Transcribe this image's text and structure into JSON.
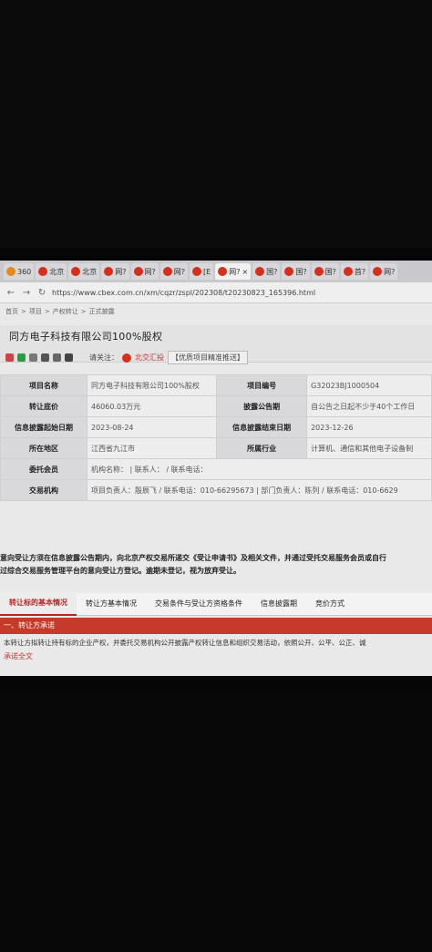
{
  "browser": {
    "tabs": [
      {
        "label": "360",
        "icon": "360-icon",
        "active": false
      },
      {
        "label": "北京",
        "icon": "site-icon",
        "active": false
      },
      {
        "label": "北京",
        "icon": "site-icon",
        "active": false
      },
      {
        "label": "网?",
        "icon": "site-icon",
        "active": false
      },
      {
        "label": "网?",
        "icon": "site-icon",
        "active": false
      },
      {
        "label": "网?",
        "icon": "site-icon",
        "active": false
      },
      {
        "label": "[E",
        "icon": "site-icon",
        "active": false
      },
      {
        "label": "网?",
        "icon": "site-icon",
        "active": true
      },
      {
        "label": "国?",
        "icon": "site-icon",
        "active": false
      },
      {
        "label": "国?",
        "icon": "site-icon",
        "active": false
      },
      {
        "label": "国?",
        "icon": "site-icon",
        "active": false
      },
      {
        "label": "首?",
        "icon": "site-icon",
        "active": false
      },
      {
        "label": "网?",
        "icon": "site-icon",
        "active": false
      }
    ],
    "url": "https://www.cbex.com.cn/xm/cqzr/zspl/202308/t20230823_165396.html"
  },
  "breadcrumb": [
    "首页",
    ">",
    "项目",
    ">",
    "产权转让",
    ">",
    "正式披露"
  ],
  "page_title": "同方电子科技有限公司100%股权",
  "actions": {
    "follow_label": "请关注：",
    "exchange_label": "北交汇投",
    "tag_label": "【优质项目精准推送】"
  },
  "info_table": [
    {
      "label": "项目名称",
      "value": "同方电子科技有限公司100%股权",
      "label2": "项目编号",
      "value2": "G32023BJ1000504"
    },
    {
      "label": "转让底价",
      "value": "46060.03万元",
      "label2": "披露公告期",
      "value2": "自公告之日起不少于40个工作日"
    },
    {
      "label": "信息披露起始日期",
      "value": "2023-08-24",
      "label2": "信息披露结束日期",
      "value2": "2023-12-26"
    },
    {
      "label": "所在地区",
      "value": "江西省九江市",
      "label2": "所属行业",
      "value2": "计算机、通信和其他电子设备制"
    },
    {
      "label": "委托会员",
      "value": "机构名称：   | 联系人：   / 联系电话："
    },
    {
      "label": "交易机构",
      "value": "项目负责人：殷辰飞 / 联系电话：010-66295673 | 部门负责人：陈列 / 联系电话：010-6629"
    }
  ],
  "notice": [
    "意向受让方须在信息披露公告期内，向北京产权交易所递交《受让申请书》及相关文件，并通过受托交易服务会员或自行",
    "过综合交易服务管理平台的意向受让方登记。逾期未登记，视为放弃受让。"
  ],
  "detail_tabs": [
    "转让标的基本情况",
    "转让方基本情况",
    "交易条件与受让方资格条件",
    "信息披露期",
    "竞价方式"
  ],
  "section_title": "一、转让方承诺",
  "promise_text": "本转让方拟转让持有标的企业产权，并委托交易机构公开披露产权转让信息和组织交易活动，依照公开、公平、公正、诚",
  "promise_link": "承诺全文",
  "colors": {
    "accent": "#c63a2a",
    "link": "#cc3333"
  }
}
